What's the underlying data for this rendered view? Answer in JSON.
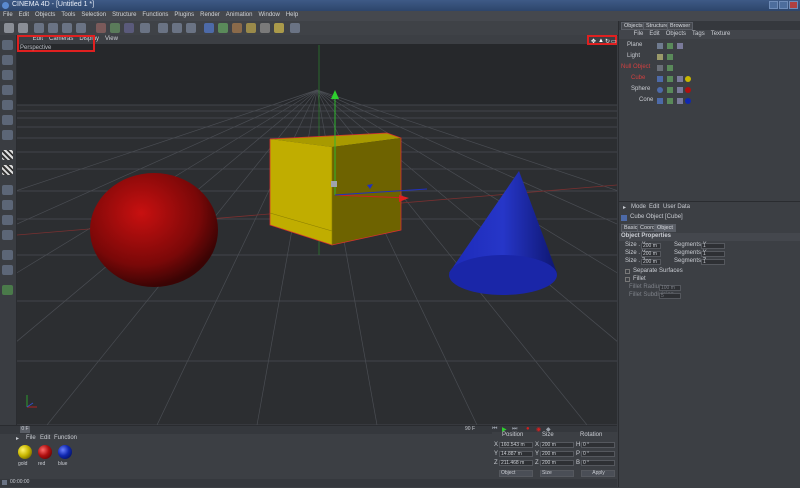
{
  "window": {
    "title": "CINEMA 4D - [Untitled 1 *]"
  },
  "menu": [
    "File",
    "Edit",
    "Objects",
    "Tools",
    "Selection",
    "Structure",
    "Functions",
    "Plugins",
    "Render",
    "Animation",
    "Window",
    "Help"
  ],
  "viewport": {
    "menu": [
      "Edit",
      "Cameras",
      "Display",
      "View"
    ],
    "name": "Perspective"
  },
  "object_manager": {
    "tabs": [
      "Objects",
      "Structure",
      "Browser"
    ],
    "menu": [
      "File",
      "Edit",
      "Objects",
      "Tags",
      "Texture"
    ],
    "items": [
      {
        "name": "Plane",
        "color": "#5d6b86"
      },
      {
        "name": "Light",
        "color": "#5d6b86"
      },
      {
        "name": "Null Object",
        "color": "#6a6f78"
      },
      {
        "name": "Cube",
        "color": "#c9b700"
      },
      {
        "name": "Sphere",
        "color": "#b01010"
      },
      {
        "name": "Cone",
        "color": "#1020a0"
      }
    ]
  },
  "attributes": {
    "menu": [
      "Mode",
      "Edit",
      "User Data"
    ],
    "header": "Cube Object [Cube]",
    "tabs": [
      "Basic",
      "Coord.",
      "Object"
    ],
    "section": "Object Properties",
    "size_x": "200 m",
    "size_y": "200 m",
    "size_z": "200 m",
    "seg_x": "1",
    "seg_y": "1",
    "seg_z": "1",
    "size_x_label": "Size . X",
    "size_y_label": "Size . Y",
    "size_z_label": "Size . Z",
    "seg_x_label": "Segments X",
    "seg_y_label": "Segments Y",
    "seg_z_label": "Segments Z",
    "separate": "Separate Surfaces",
    "fillet": "Fillet",
    "fillet_radius_label": "Fillet Radius",
    "fillet_radius": "100 m",
    "fillet_sub_label": "Fillet Subdivision",
    "fillet_sub": "5"
  },
  "material_manager": {
    "menu": [
      "File",
      "Edit",
      "Function"
    ],
    "materials": [
      {
        "name": "gold",
        "color": "#c9b700"
      },
      {
        "name": "red",
        "color": "#b01010"
      },
      {
        "name": "blue",
        "color": "#1028b0"
      }
    ]
  },
  "coordinates": {
    "headers": [
      "Position",
      "Size",
      "Rotation"
    ],
    "pos": [
      "160.543 m",
      "14.887 m",
      "211.468 m"
    ],
    "size": [
      "200 m",
      "200 m",
      "200 m"
    ],
    "rot": [
      "0 °",
      "0 °",
      "0 °"
    ],
    "axes": [
      "X",
      "Y",
      "Z"
    ],
    "rot_axes": [
      "H",
      "P",
      "B"
    ],
    "mode1": "Object",
    "mode2": "Size",
    "apply": "Apply"
  },
  "timeline": {
    "frame": "0 F",
    "end": "90 F"
  },
  "status": {
    "time": "00:00:00"
  }
}
